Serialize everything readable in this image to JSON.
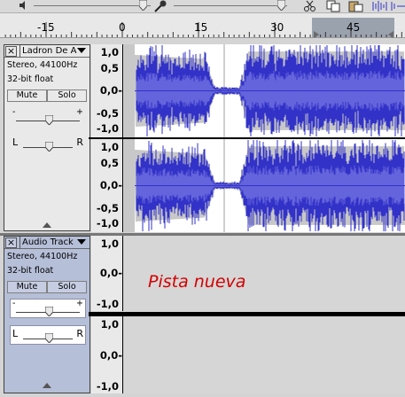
{
  "colors": {
    "waveform": "#3232c8",
    "waveform_rms": "#6464dc",
    "wave_background": "#ffffff",
    "envelope_fill": "#c8c8c8",
    "selected_track_panel": "#b6bfd8",
    "new_track_text": "#d40000"
  },
  "ruler": {
    "labels": [
      "-15",
      "0",
      "15",
      "30",
      "45"
    ]
  },
  "tracks": [
    {
      "name": "Ladron De A",
      "info_format": "Stereo, 44100Hz",
      "info_bits": "32-bit float",
      "mute_label": "Mute",
      "solo_label": "Solo",
      "gain_minus": "-",
      "gain_plus": "+",
      "pan_left": "L",
      "pan_right": "R",
      "channels": [
        {
          "scale": [
            "1,0",
            "0,5",
            "0,0-",
            "-0,5",
            "-1,0"
          ]
        },
        {
          "scale": [
            "1,0",
            "0,5",
            "0,0-",
            "-0,5",
            "-1,0"
          ]
        }
      ]
    },
    {
      "name": "Audio Track",
      "info_format": "Stereo, 44100Hz",
      "info_bits": "32-bit float",
      "mute_label": "Mute",
      "solo_label": "Solo",
      "gain_minus": "-",
      "gain_plus": "+",
      "pan_left": "L",
      "pan_right": "R",
      "channels": [
        {
          "scale": [
            "1,0",
            "0,0-",
            "-1,0"
          ]
        },
        {
          "scale": [
            "1,0",
            "0,0-",
            "-1,0"
          ]
        }
      ],
      "overlay_text": "Pista nueva"
    }
  ],
  "icons": {
    "close": "close-icon",
    "menu": "track-menu-arrow-icon",
    "collapse": "collapse-arrow-icon",
    "speaker": "speaker-icon",
    "mic": "microphone-icon"
  }
}
